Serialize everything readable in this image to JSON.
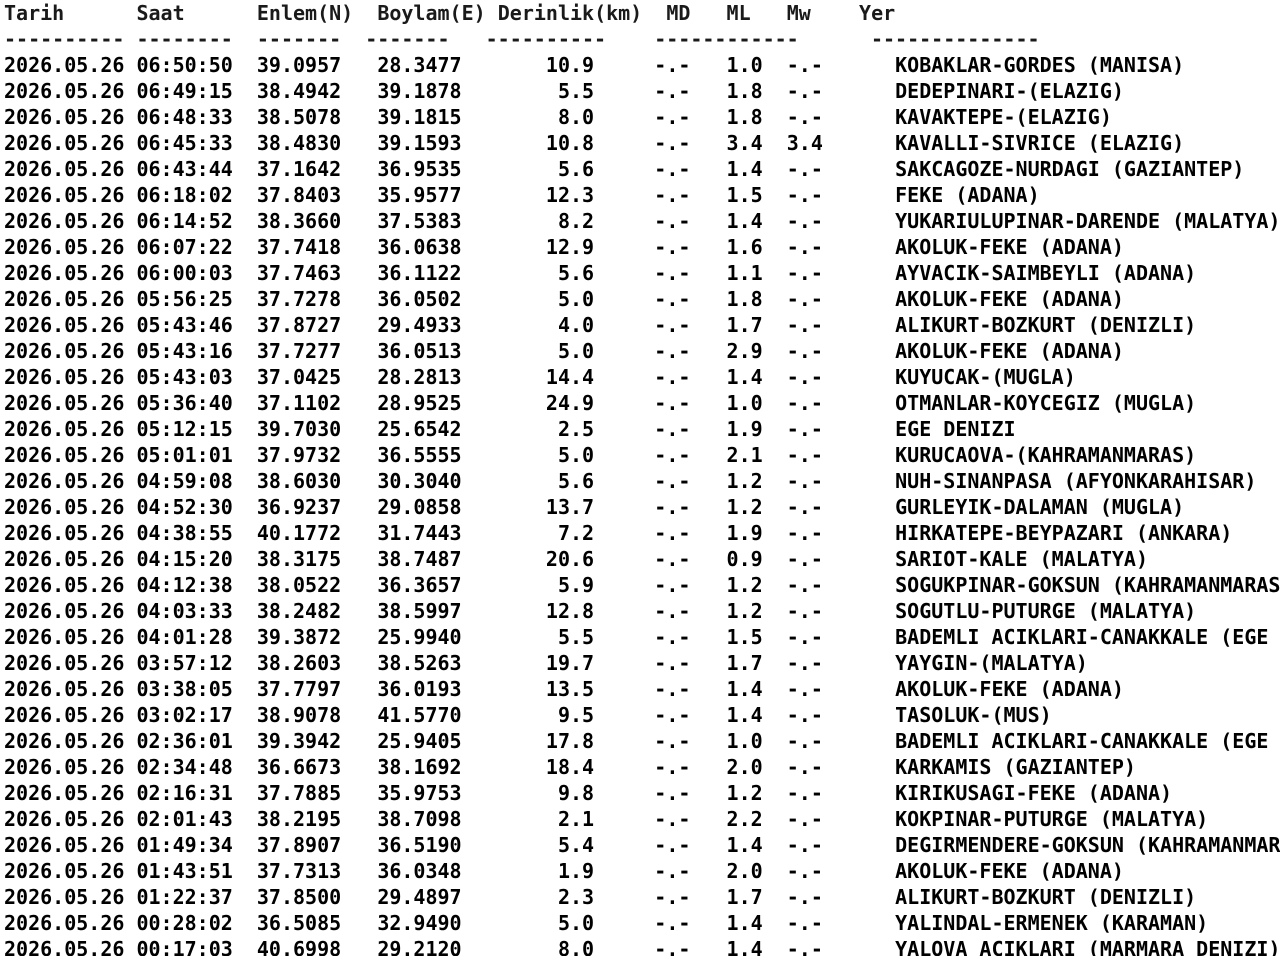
{
  "header": {
    "tarih": "Tarih",
    "saat": "Saat",
    "enlem": "Enlem(N)",
    "boylam": "Boylam(E)",
    "derinlik": "Derinlik(km)",
    "md": "MD",
    "ml": "ML",
    "mw": "Mw",
    "yer": "Yer"
  },
  "separator": "---------- --------  -------  -------   ----------    ------------      --------------",
  "events": [
    {
      "date": "2026.05.26",
      "time": "06:50:50",
      "lat": "39.0957",
      "lon": "28.3477",
      "depth": "10.9",
      "md": "-.-",
      "ml": "1.0",
      "mw": "-.-",
      "place": "KOBAKLAR-GORDES (MANISA)"
    },
    {
      "date": "2026.05.26",
      "time": "06:49:15",
      "lat": "38.4942",
      "lon": "39.1878",
      "depth": "5.5",
      "md": "-.-",
      "ml": "1.8",
      "mw": "-.-",
      "place": "DEDEPINARI-(ELAZIG)"
    },
    {
      "date": "2026.05.26",
      "time": "06:48:33",
      "lat": "38.5078",
      "lon": "39.1815",
      "depth": "8.0",
      "md": "-.-",
      "ml": "1.8",
      "mw": "-.-",
      "place": "KAVAKTEPE-(ELAZIG)"
    },
    {
      "date": "2026.05.26",
      "time": "06:45:33",
      "lat": "38.4830",
      "lon": "39.1593",
      "depth": "10.8",
      "md": "-.-",
      "ml": "3.4",
      "mw": "3.4",
      "place": "KAVALLI-SIVRICE (ELAZIG)"
    },
    {
      "date": "2026.05.26",
      "time": "06:43:44",
      "lat": "37.1642",
      "lon": "36.9535",
      "depth": "5.6",
      "md": "-.-",
      "ml": "1.4",
      "mw": "-.-",
      "place": "SAKCAGOZE-NURDAGI (GAZIANTEP)"
    },
    {
      "date": "2026.05.26",
      "time": "06:18:02",
      "lat": "37.8403",
      "lon": "35.9577",
      "depth": "12.3",
      "md": "-.-",
      "ml": "1.5",
      "mw": "-.-",
      "place": "FEKE (ADANA)"
    },
    {
      "date": "2026.05.26",
      "time": "06:14:52",
      "lat": "38.3660",
      "lon": "37.5383",
      "depth": "8.2",
      "md": "-.-",
      "ml": "1.4",
      "mw": "-.-",
      "place": "YUKARIULUPINAR-DARENDE (MALATYA)"
    },
    {
      "date": "2026.05.26",
      "time": "06:07:22",
      "lat": "37.7418",
      "lon": "36.0638",
      "depth": "12.9",
      "md": "-.-",
      "ml": "1.6",
      "mw": "-.-",
      "place": "AKOLUK-FEKE (ADANA)"
    },
    {
      "date": "2026.05.26",
      "time": "06:00:03",
      "lat": "37.7463",
      "lon": "36.1122",
      "depth": "5.6",
      "md": "-.-",
      "ml": "1.1",
      "mw": "-.-",
      "place": "AYVACIK-SAIMBEYLI (ADANA)"
    },
    {
      "date": "2026.05.26",
      "time": "05:56:25",
      "lat": "37.7278",
      "lon": "36.0502",
      "depth": "5.0",
      "md": "-.-",
      "ml": "1.8",
      "mw": "-.-",
      "place": "AKOLUK-FEKE (ADANA)"
    },
    {
      "date": "2026.05.26",
      "time": "05:43:46",
      "lat": "37.8727",
      "lon": "29.4933",
      "depth": "4.0",
      "md": "-.-",
      "ml": "1.7",
      "mw": "-.-",
      "place": "ALIKURT-BOZKURT (DENIZLI)"
    },
    {
      "date": "2026.05.26",
      "time": "05:43:16",
      "lat": "37.7277",
      "lon": "36.0513",
      "depth": "5.0",
      "md": "-.-",
      "ml": "2.9",
      "mw": "-.-",
      "place": "AKOLUK-FEKE (ADANA)"
    },
    {
      "date": "2026.05.26",
      "time": "05:43:03",
      "lat": "37.0425",
      "lon": "28.2813",
      "depth": "14.4",
      "md": "-.-",
      "ml": "1.4",
      "mw": "-.-",
      "place": "KUYUCAK-(MUGLA)"
    },
    {
      "date": "2026.05.26",
      "time": "05:36:40",
      "lat": "37.1102",
      "lon": "28.9525",
      "depth": "24.9",
      "md": "-.-",
      "ml": "1.0",
      "mw": "-.-",
      "place": "OTMANLAR-KOYCEGIZ (MUGLA)"
    },
    {
      "date": "2026.05.26",
      "time": "05:12:15",
      "lat": "39.7030",
      "lon": "25.6542",
      "depth": "2.5",
      "md": "-.-",
      "ml": "1.9",
      "mw": "-.-",
      "place": "EGE DENIZI"
    },
    {
      "date": "2026.05.26",
      "time": "05:01:01",
      "lat": "37.9732",
      "lon": "36.5555",
      "depth": "5.0",
      "md": "-.-",
      "ml": "2.1",
      "mw": "-.-",
      "place": "KURUCAOVA-(KAHRAMANMARAS)"
    },
    {
      "date": "2026.05.26",
      "time": "04:59:08",
      "lat": "38.6030",
      "lon": "30.3040",
      "depth": "5.6",
      "md": "-.-",
      "ml": "1.2",
      "mw": "-.-",
      "place": "NUH-SINANPASA (AFYONKARAHISAR)"
    },
    {
      "date": "2026.05.26",
      "time": "04:52:30",
      "lat": "36.9237",
      "lon": "29.0858",
      "depth": "13.7",
      "md": "-.-",
      "ml": "1.2",
      "mw": "-.-",
      "place": "GURLEYIK-DALAMAN (MUGLA)"
    },
    {
      "date": "2026.05.26",
      "time": "04:38:55",
      "lat": "40.1772",
      "lon": "31.7443",
      "depth": "7.2",
      "md": "-.-",
      "ml": "1.9",
      "mw": "-.-",
      "place": "HIRKATEPE-BEYPAZARI (ANKARA)"
    },
    {
      "date": "2026.05.26",
      "time": "04:15:20",
      "lat": "38.3175",
      "lon": "38.7487",
      "depth": "20.6",
      "md": "-.-",
      "ml": "0.9",
      "mw": "-.-",
      "place": "SARIOT-KALE (MALATYA)"
    },
    {
      "date": "2026.05.26",
      "time": "04:12:38",
      "lat": "38.0522",
      "lon": "36.3657",
      "depth": "5.9",
      "md": "-.-",
      "ml": "1.2",
      "mw": "-.-",
      "place": "SOGUKPINAR-GOKSUN (KAHRAMANMARAS)"
    },
    {
      "date": "2026.05.26",
      "time": "04:03:33",
      "lat": "38.2482",
      "lon": "38.5997",
      "depth": "12.8",
      "md": "-.-",
      "ml": "1.2",
      "mw": "-.-",
      "place": "SOGUTLU-PUTURGE (MALATYA)"
    },
    {
      "date": "2026.05.26",
      "time": "04:01:28",
      "lat": "39.3872",
      "lon": "25.9940",
      "depth": "5.5",
      "md": "-.-",
      "ml": "1.5",
      "mw": "-.-",
      "place": "BADEMLI ACIKLARI-CANAKKALE (EGE D"
    },
    {
      "date": "2026.05.26",
      "time": "03:57:12",
      "lat": "38.2603",
      "lon": "38.5263",
      "depth": "19.7",
      "md": "-.-",
      "ml": "1.7",
      "mw": "-.-",
      "place": "YAYGIN-(MALATYA)"
    },
    {
      "date": "2026.05.26",
      "time": "03:38:05",
      "lat": "37.7797",
      "lon": "36.0193",
      "depth": "13.5",
      "md": "-.-",
      "ml": "1.4",
      "mw": "-.-",
      "place": "AKOLUK-FEKE (ADANA)"
    },
    {
      "date": "2026.05.26",
      "time": "03:02:17",
      "lat": "38.9078",
      "lon": "41.5770",
      "depth": "9.5",
      "md": "-.-",
      "ml": "1.4",
      "mw": "-.-",
      "place": "TASOLUK-(MUS)"
    },
    {
      "date": "2026.05.26",
      "time": "02:36:01",
      "lat": "39.3942",
      "lon": "25.9405",
      "depth": "17.8",
      "md": "-.-",
      "ml": "1.0",
      "mw": "-.-",
      "place": "BADEMLI ACIKLARI-CANAKKALE (EGE D"
    },
    {
      "date": "2026.05.26",
      "time": "02:34:48",
      "lat": "36.6673",
      "lon": "38.1692",
      "depth": "18.4",
      "md": "-.-",
      "ml": "2.0",
      "mw": "-.-",
      "place": "KARKAMIS (GAZIANTEP)"
    },
    {
      "date": "2026.05.26",
      "time": "02:16:31",
      "lat": "37.7885",
      "lon": "35.9753",
      "depth": "9.8",
      "md": "-.-",
      "ml": "1.2",
      "mw": "-.-",
      "place": "KIRIKUSAGI-FEKE (ADANA)"
    },
    {
      "date": "2026.05.26",
      "time": "02:01:43",
      "lat": "38.2195",
      "lon": "38.7098",
      "depth": "2.1",
      "md": "-.-",
      "ml": "2.2",
      "mw": "-.-",
      "place": "KOKPINAR-PUTURGE (MALATYA)"
    },
    {
      "date": "2026.05.26",
      "time": "01:49:34",
      "lat": "37.8907",
      "lon": "36.5190",
      "depth": "5.4",
      "md": "-.-",
      "ml": "1.4",
      "mw": "-.-",
      "place": "DEGIRMENDERE-GOKSUN (KAHRAMANMARA"
    },
    {
      "date": "2026.05.26",
      "time": "01:43:51",
      "lat": "37.7313",
      "lon": "36.0348",
      "depth": "1.9",
      "md": "-.-",
      "ml": "2.0",
      "mw": "-.-",
      "place": "AKOLUK-FEKE (ADANA)"
    },
    {
      "date": "2026.05.26",
      "time": "01:22:37",
      "lat": "37.8500",
      "lon": "29.4897",
      "depth": "2.3",
      "md": "-.-",
      "ml": "1.7",
      "mw": "-.-",
      "place": "ALIKURT-BOZKURT (DENIZLI)"
    },
    {
      "date": "2026.05.26",
      "time": "00:28:02",
      "lat": "36.5085",
      "lon": "32.9490",
      "depth": "5.0",
      "md": "-.-",
      "ml": "1.4",
      "mw": "-.-",
      "place": "YALINDAL-ERMENEK (KARAMAN)"
    },
    {
      "date": "2026.05.26",
      "time": "00:17:03",
      "lat": "40.6998",
      "lon": "29.2120",
      "depth": "8.0",
      "md": "-.-",
      "ml": "1.4",
      "mw": "-.-",
      "place": "YALOVA ACIKLARI (MARMARA DENIZI)"
    }
  ]
}
